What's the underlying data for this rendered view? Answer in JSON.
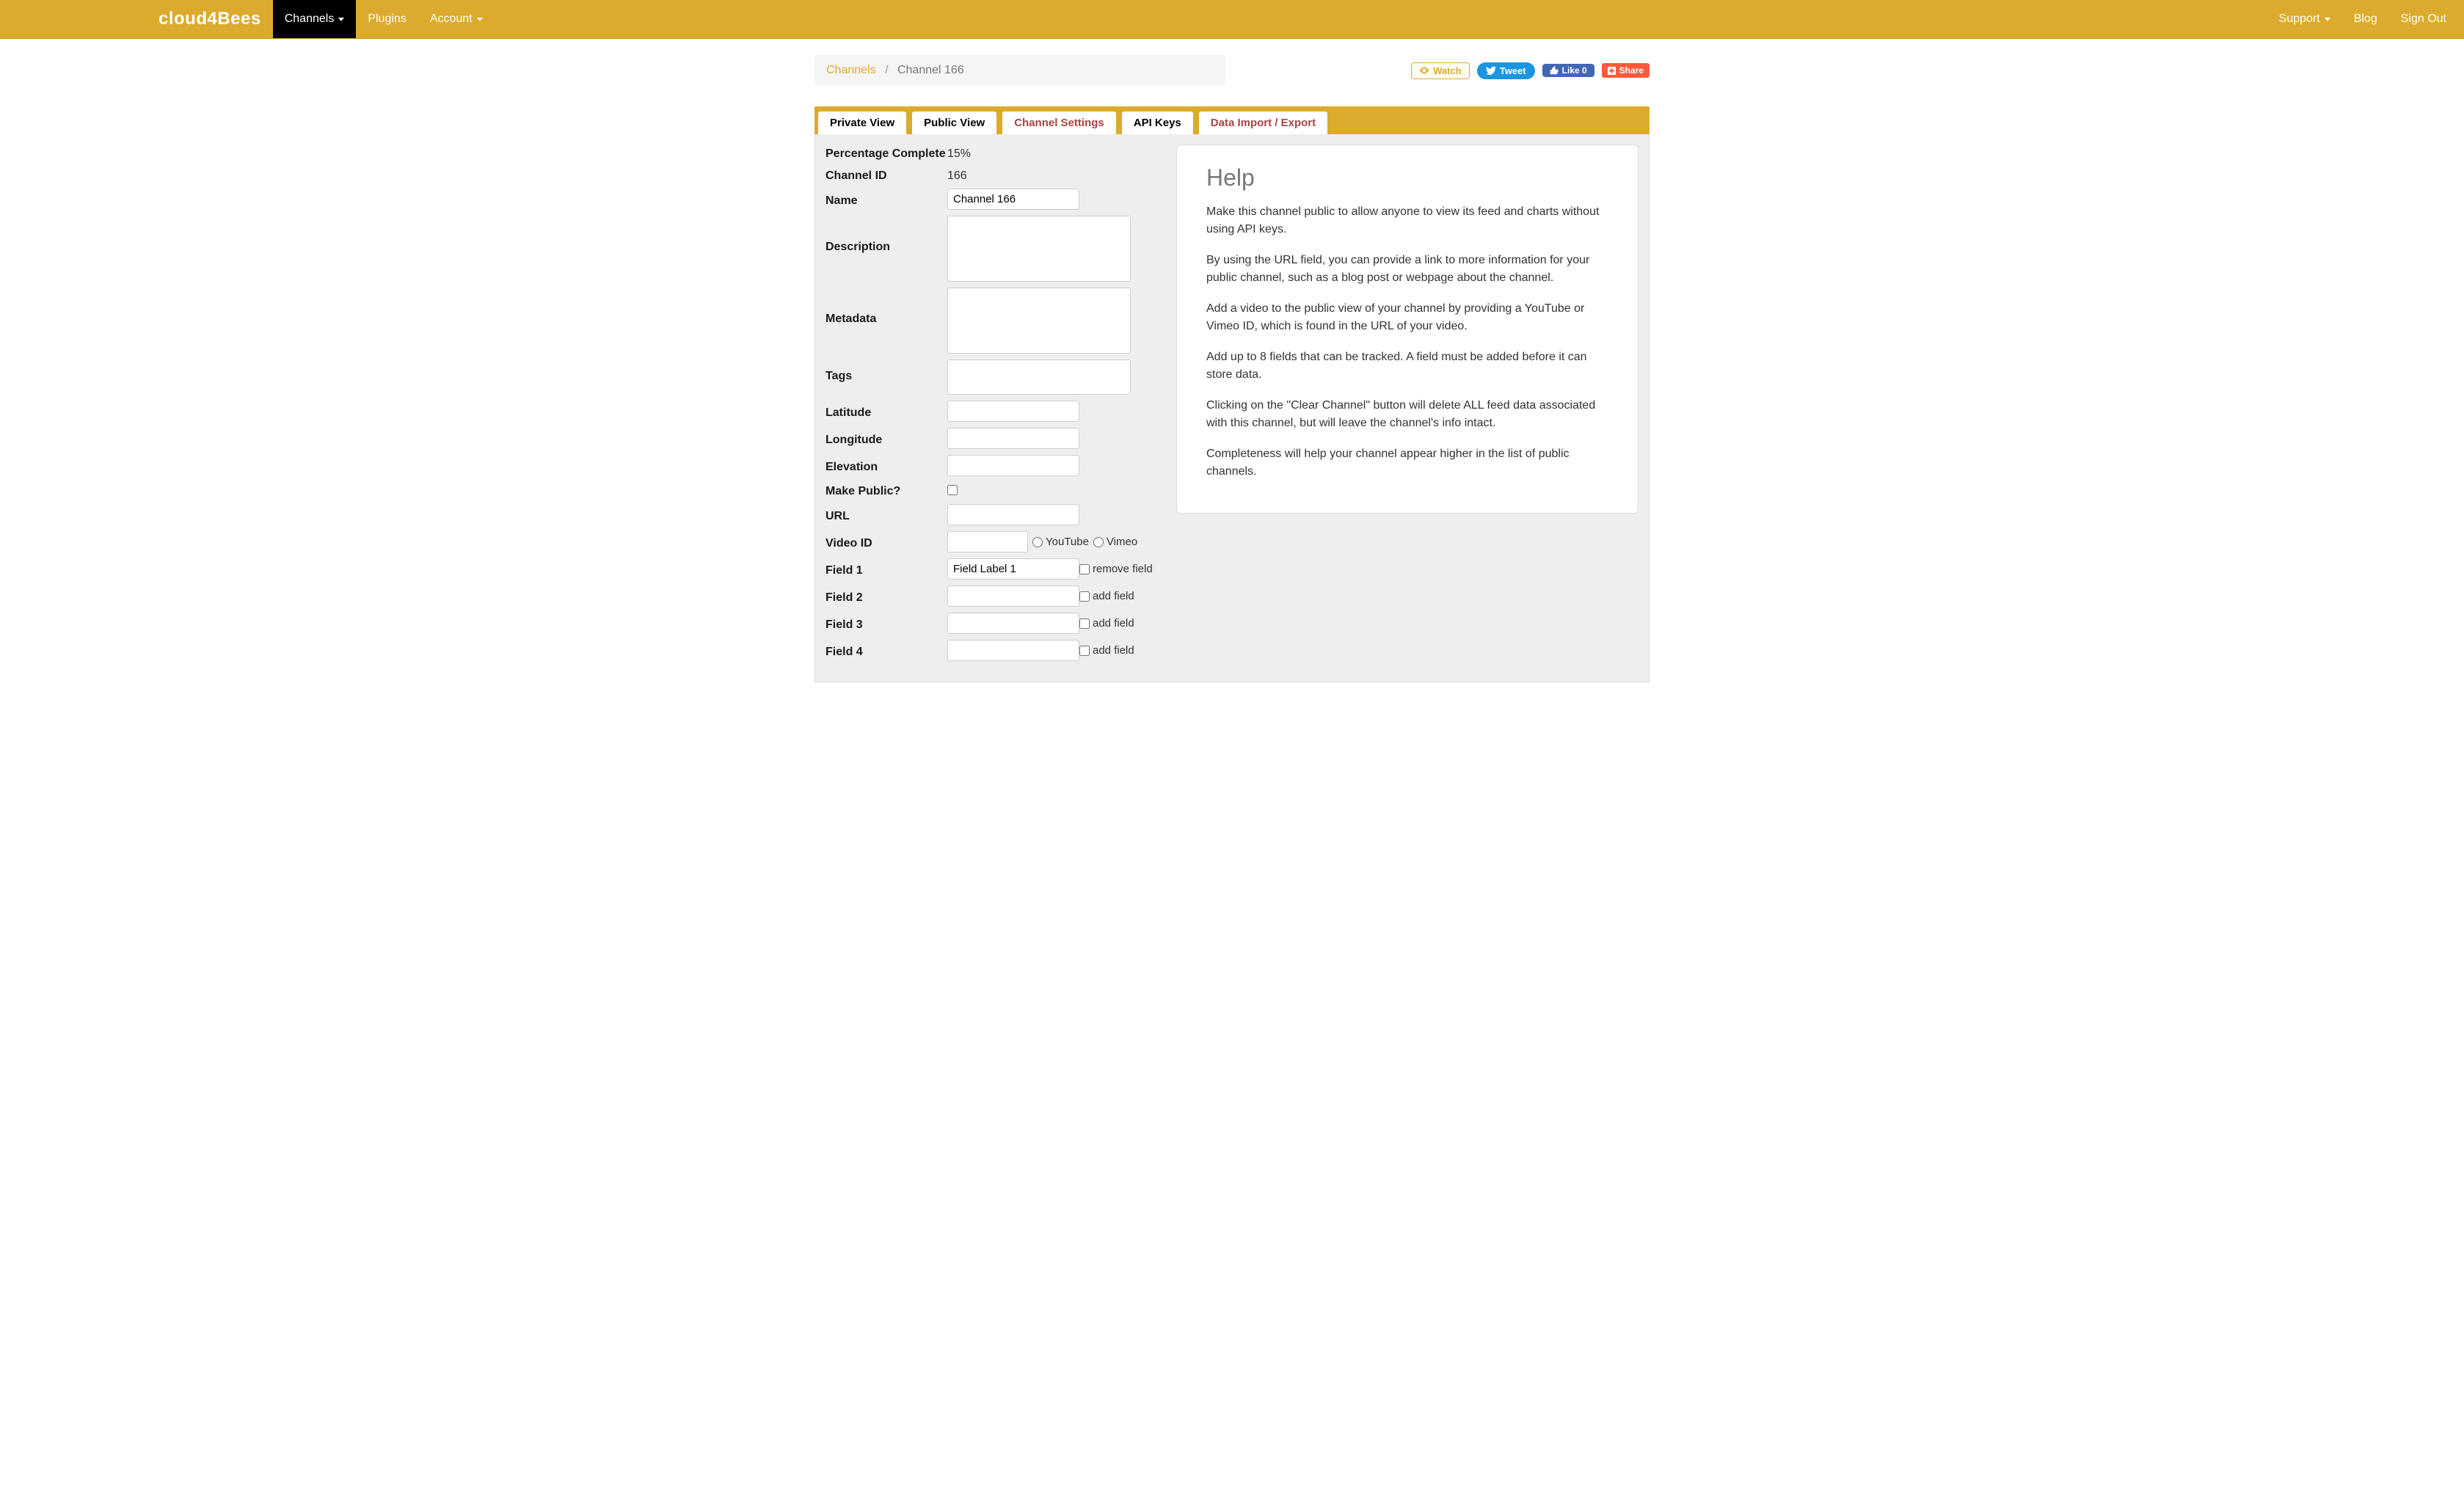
{
  "brand": "cloud4Bees",
  "nav": {
    "channels": "Channels",
    "plugins": "Plugins",
    "account": "Account",
    "support": "Support",
    "blog": "Blog",
    "signout": "Sign Out"
  },
  "breadcrumb": {
    "channels": "Channels",
    "current": "Channel 166"
  },
  "social": {
    "watch": "Watch",
    "tweet": "Tweet",
    "like": "Like 0",
    "share": "Share"
  },
  "tabs": {
    "private_view": "Private View",
    "public_view": "Public View",
    "channel_settings": "Channel Settings",
    "api_keys": "API Keys",
    "data_io": "Data Import / Export"
  },
  "form": {
    "labels": {
      "percentage_complete": "Percentage Complete",
      "channel_id": "Channel ID",
      "name": "Name",
      "description": "Description",
      "metadata": "Metadata",
      "tags": "Tags",
      "latitude": "Latitude",
      "longitude": "Longitude",
      "elevation": "Elevation",
      "make_public": "Make Public?",
      "url": "URL",
      "video_id": "Video ID",
      "field1": "Field 1",
      "field2": "Field 2",
      "field3": "Field 3",
      "field4": "Field 4"
    },
    "video": {
      "youtube": "YouTube",
      "vimeo": "Vimeo"
    },
    "field_actions": {
      "remove": "remove field",
      "add": "add field"
    },
    "values": {
      "percentage_complete": "15%",
      "channel_id": "166",
      "name": "Channel 166",
      "description": "",
      "metadata": "",
      "tags": "",
      "latitude": "",
      "longitude": "",
      "elevation": "",
      "url": "",
      "video_id": "",
      "field1": "Field Label 1",
      "field2": "",
      "field3": "",
      "field4": ""
    }
  },
  "help": {
    "title": "Help",
    "p1": "Make this channel public to allow anyone to view its feed and charts without using API keys.",
    "p2": "By using the URL field, you can provide a link to more information for your public channel, such as a blog post or webpage about the channel.",
    "p3": "Add a video to the public view of your channel by providing a YouTube or Vimeo ID, which is found in the URL of your video.",
    "p4": "Add up to 8 fields that can be tracked. A field must be added before it can store data.",
    "p5": "Clicking on the \"Clear Channel\" button will delete ALL feed data associated with this channel, but will leave the channel's info intact.",
    "p6": "Completeness will help your channel appear higher in the list of public channels."
  }
}
